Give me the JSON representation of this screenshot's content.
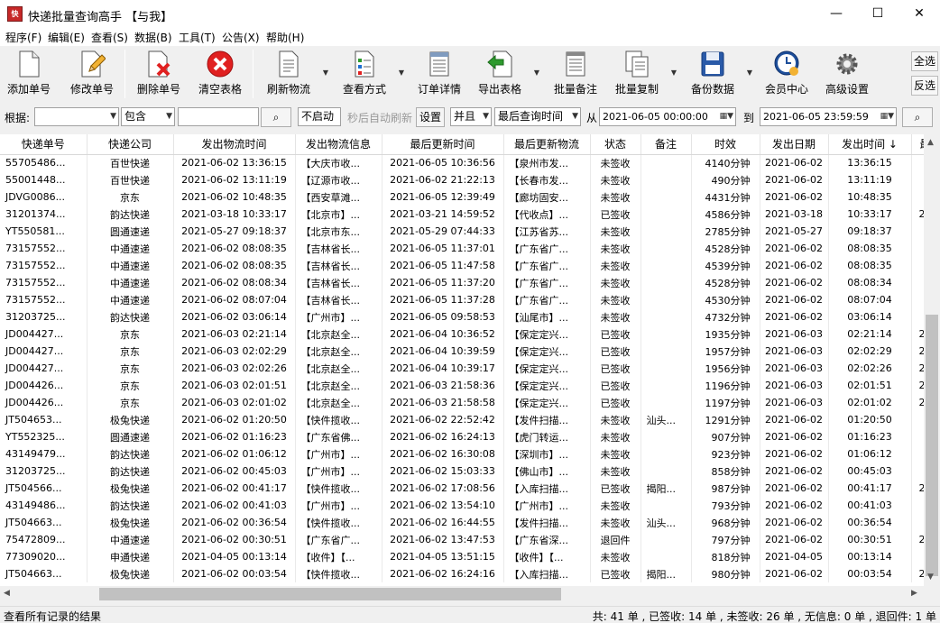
{
  "window": {
    "title": "快递批量查询高手 【与我】",
    "app_icon_text": "快递",
    "minimize": "—",
    "maximize": "☐",
    "close": "✕"
  },
  "menu": [
    "程序(F)",
    "编辑(E)",
    "查看(S)",
    "数据(B)",
    "工具(T)",
    "公告(X)",
    "帮助(H)"
  ],
  "toolbar": {
    "add": "添加单号",
    "edit": "修改单号",
    "delete": "删除单号",
    "clear": "清空表格",
    "refresh": "刷新物流",
    "view_mode": "查看方式",
    "detail": "订单详情",
    "export": "导出表格",
    "batch_note": "批量备注",
    "batch_copy": "批量复制",
    "backup": "备份数据",
    "member": "会员中心",
    "settings": "高级设置",
    "select_all": "全选",
    "invert": "反选"
  },
  "filter": {
    "basis_label": "根据:",
    "basis_value": "",
    "contains_value": "包含",
    "keyword": "",
    "auto_value": "不启动",
    "auto_text": "秒后自动刷新",
    "set": "设置",
    "and_value": "并且",
    "time_field": "最后查询时间",
    "from_label": "从",
    "from_value": "2021-06-05 00:00:00",
    "to_label": "到",
    "to_value": "2021-06-05 23:59:59"
  },
  "columns": [
    "快递单号",
    "快递公司",
    "发出物流时间",
    "发出物流信息",
    "最后更新时间",
    "最后更新物流",
    "状态",
    "备注",
    "时效",
    "发出日期",
    "发出时间 ↓",
    "最"
  ],
  "rows": [
    [
      "55705486...",
      "百世快递",
      "2021-06-02 13:36:15",
      "【大庆市收...",
      "2021-06-05 10:36:56",
      "【泉州市发...",
      "未签收",
      "",
      "4140分钟",
      "2021-06-02",
      "13:36:15",
      ""
    ],
    [
      "55001448...",
      "百世快递",
      "2021-06-02 13:11:19",
      "【辽源市收...",
      "2021-06-02 21:22:13",
      "【长春市发...",
      "未签收",
      "",
      "490分钟",
      "2021-06-02",
      "13:11:19",
      ""
    ],
    [
      "JDVG0086...",
      "京东",
      "2021-06-02 10:48:35",
      "【西安草滩...",
      "2021-06-05 12:39:49",
      "【廊坊固安...",
      "未签收",
      "",
      "4431分钟",
      "2021-06-02",
      "10:48:35",
      ""
    ],
    [
      "31201374...",
      "韵达快递",
      "2021-03-18 10:33:17",
      "【北京市】...",
      "2021-03-21 14:59:52",
      "【代收点】...",
      "已签收",
      "",
      "4586分钟",
      "2021-03-18",
      "10:33:17",
      "20"
    ],
    [
      "YT550581...",
      "圆通速递",
      "2021-05-27 09:18:37",
      "【北京市东...",
      "2021-05-29 07:44:33",
      "【江苏省苏...",
      "未签收",
      "",
      "2785分钟",
      "2021-05-27",
      "09:18:37",
      ""
    ],
    [
      "73157552...",
      "中通速递",
      "2021-06-02 08:08:35",
      "【吉林省长...",
      "2021-06-05 11:37:01",
      "【广东省广...",
      "未签收",
      "",
      "4528分钟",
      "2021-06-02",
      "08:08:35",
      ""
    ],
    [
      "73157552...",
      "中通速递",
      "2021-06-02 08:08:35",
      "【吉林省长...",
      "2021-06-05 11:47:58",
      "【广东省广...",
      "未签收",
      "",
      "4539分钟",
      "2021-06-02",
      "08:08:35",
      ""
    ],
    [
      "73157552...",
      "中通速递",
      "2021-06-02 08:08:34",
      "【吉林省长...",
      "2021-06-05 11:37:20",
      "【广东省广...",
      "未签收",
      "",
      "4528分钟",
      "2021-06-02",
      "08:08:34",
      ""
    ],
    [
      "73157552...",
      "中通速递",
      "2021-06-02 08:07:04",
      "【吉林省长...",
      "2021-06-05 11:37:28",
      "【广东省广...",
      "未签收",
      "",
      "4530分钟",
      "2021-06-02",
      "08:07:04",
      ""
    ],
    [
      "31203725...",
      "韵达快递",
      "2021-06-02 03:06:14",
      "【广州市】...",
      "2021-06-05 09:58:53",
      "【汕尾市】...",
      "未签收",
      "",
      "4732分钟",
      "2021-06-02",
      "03:06:14",
      ""
    ],
    [
      "JD004427...",
      "京东",
      "2021-06-03 02:21:14",
      "【北京赵全...",
      "2021-06-04 10:36:52",
      "【保定定兴...",
      "已签收",
      "",
      "1935分钟",
      "2021-06-03",
      "02:21:14",
      "20"
    ],
    [
      "JD004427...",
      "京东",
      "2021-06-03 02:02:29",
      "【北京赵全...",
      "2021-06-04 10:39:59",
      "【保定定兴...",
      "已签收",
      "",
      "1957分钟",
      "2021-06-03",
      "02:02:29",
      "20"
    ],
    [
      "JD004427...",
      "京东",
      "2021-06-03 02:02:26",
      "【北京赵全...",
      "2021-06-04 10:39:17",
      "【保定定兴...",
      "已签收",
      "",
      "1956分钟",
      "2021-06-03",
      "02:02:26",
      "20"
    ],
    [
      "JD004426...",
      "京东",
      "2021-06-03 02:01:51",
      "【北京赵全...",
      "2021-06-03 21:58:36",
      "【保定定兴...",
      "已签收",
      "",
      "1196分钟",
      "2021-06-03",
      "02:01:51",
      "20"
    ],
    [
      "JD004426...",
      "京东",
      "2021-06-03 02:01:02",
      "【北京赵全...",
      "2021-06-03 21:58:58",
      "【保定定兴...",
      "已签收",
      "",
      "1197分钟",
      "2021-06-03",
      "02:01:02",
      "20"
    ],
    [
      "JT504653...",
      "极兔快递",
      "2021-06-02 01:20:50",
      "【快件揽收...",
      "2021-06-02 22:52:42",
      "【发件扫描...",
      "未签收",
      "汕头...",
      "1291分钟",
      "2021-06-02",
      "01:20:50",
      ""
    ],
    [
      "YT552325...",
      "圆通速递",
      "2021-06-02 01:16:23",
      "【广东省佛...",
      "2021-06-02 16:24:13",
      "【虎门转运...",
      "未签收",
      "",
      "907分钟",
      "2021-06-02",
      "01:16:23",
      ""
    ],
    [
      "43149479...",
      "韵达快递",
      "2021-06-02 01:06:12",
      "【广州市】...",
      "2021-06-02 16:30:08",
      "【深圳市】...",
      "未签收",
      "",
      "923分钟",
      "2021-06-02",
      "01:06:12",
      ""
    ],
    [
      "31203725...",
      "韵达快递",
      "2021-06-02 00:45:03",
      "【广州市】...",
      "2021-06-02 15:03:33",
      "【佛山市】...",
      "未签收",
      "",
      "858分钟",
      "2021-06-02",
      "00:45:03",
      ""
    ],
    [
      "JT504566...",
      "极兔快递",
      "2021-06-02 00:41:17",
      "【快件揽收...",
      "2021-06-02 17:08:56",
      "【入库扫描...",
      "已签收",
      "揭阳...",
      "987分钟",
      "2021-06-02",
      "00:41:17",
      "20"
    ],
    [
      "43149486...",
      "韵达快递",
      "2021-06-02 00:41:03",
      "【广州市】...",
      "2021-06-02 13:54:10",
      "【广州市】...",
      "未签收",
      "",
      "793分钟",
      "2021-06-02",
      "00:41:03",
      ""
    ],
    [
      "JT504663...",
      "极兔快递",
      "2021-06-02 00:36:54",
      "【快件揽收...",
      "2021-06-02 16:44:55",
      "【发件扫描...",
      "未签收",
      "汕头...",
      "968分钟",
      "2021-06-02",
      "00:36:54",
      ""
    ],
    [
      "75472809...",
      "中通速递",
      "2021-06-02 00:30:51",
      "【广东省广...",
      "2021-06-02 13:47:53",
      "【广东省深...",
      "退回件",
      "",
      "797分钟",
      "2021-06-02",
      "00:30:51",
      "20"
    ],
    [
      "77309020...",
      "申通快递",
      "2021-04-05 00:13:14",
      "【收件】【...",
      "2021-04-05 13:51:15",
      "【收件】【...",
      "未签收",
      "",
      "818分钟",
      "2021-04-05",
      "00:13:14",
      ""
    ],
    [
      "JT504663...",
      "极兔快递",
      "2021-06-02 00:03:54",
      "【快件揽收...",
      "2021-06-02 16:24:16",
      "【入库扫描...",
      "已签收",
      "揭阳...",
      "980分钟",
      "2021-06-02",
      "00:03:54",
      "20"
    ]
  ],
  "status": {
    "left": "查看所有记录的结果",
    "summary": "共: 41 单 , 已签收: 14 单 , 未签收: 26 单 , 无信息: 0 单 , 退回件: 1 单"
  },
  "colors": {
    "accent": "#0078d7",
    "delete": "#e02020",
    "green": "#2e9a2e"
  }
}
